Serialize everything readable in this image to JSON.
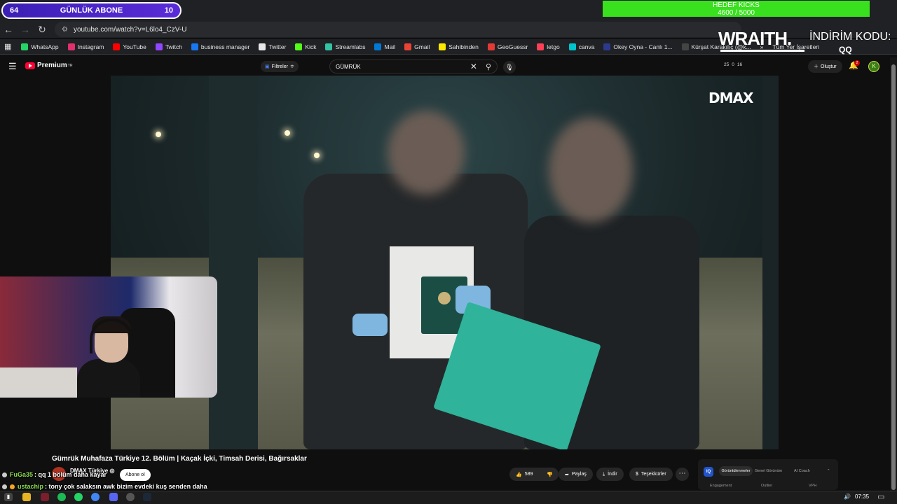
{
  "overlay": {
    "sub_left": "64",
    "sub_label": "GÜNLÜK ABONE",
    "sub_right": "10",
    "kicks_title": "HEDEF KICKS",
    "kicks_progress": "4600 / 5000",
    "kicks_fraction": 0.92,
    "brand": "WRAITH.",
    "promo_label": "İNDİRİM KODU:",
    "promo_code": "QQ"
  },
  "browser": {
    "url": "youtube.com/watch?v=L6lo4_CzV-U",
    "bookmarks": [
      {
        "label": "WhatsApp",
        "color": "#25d366"
      },
      {
        "label": "Instagram",
        "color": "#e1306c"
      },
      {
        "label": "YouTube",
        "color": "#ff0000"
      },
      {
        "label": "Twitch",
        "color": "#9146ff"
      },
      {
        "label": "business manager",
        "color": "#1877f2"
      },
      {
        "label": "Twitter",
        "color": "#e7e7e7"
      },
      {
        "label": "Kick",
        "color": "#53fc18"
      },
      {
        "label": "Streamlabs",
        "color": "#31c3a2"
      },
      {
        "label": "Mail",
        "color": "#0078d4"
      },
      {
        "label": "Gmail",
        "color": "#ea4335"
      },
      {
        "label": "Sahibinden",
        "color": "#ffe800"
      },
      {
        "label": "GeoGuessr",
        "color": "#e53935"
      },
      {
        "label": "letgo",
        "color": "#ff3f55"
      },
      {
        "label": "canva",
        "color": "#00c4cc"
      },
      {
        "label": "Okey Oyna - Canlı 1...",
        "color": "#2b3a8a"
      },
      {
        "label": "Kürşat Karakılıç (@k...",
        "color": "#444444"
      }
    ],
    "other_bookmarks": "Tüm Yer İşaretleri"
  },
  "youtube": {
    "logo_label": "Premium",
    "logo_region": "TR",
    "filters_label": "Filtreler",
    "search_value": "GÜMRÜK",
    "stats": [
      "25",
      "0",
      "16"
    ],
    "create_label": "Oluştur",
    "notification_count": "2",
    "avatar_letter": "K",
    "video_logo": "DMAX",
    "video_title": "Gümrük Muhafaza Türkiye 12. Bölüm | Kaçak İçki, Timsah Derisi, Bağırsaklar",
    "channel_name": "DMAX Türkiye ◎",
    "subscribe_label": "Abone ol",
    "like_count": "589",
    "share_label": "Paylaş",
    "download_label": "İndir",
    "thanks_label": "Teşekkürler"
  },
  "widget": {
    "logo": "IQ",
    "tabs": [
      "Görüntülenmeler",
      "Genel Görünüm",
      "AI Coach"
    ],
    "labels": [
      "Engagement",
      "Outlier",
      "VPH"
    ]
  },
  "chat": [
    {
      "user": "FuGa35",
      "message": ": qq 1 bölüm daha kayar"
    },
    {
      "user": "ustachip",
      "message": ": tony çok salaksın awk bizim evdeki kuş senden daha"
    }
  ],
  "taskbar": {
    "time": "07:35"
  }
}
